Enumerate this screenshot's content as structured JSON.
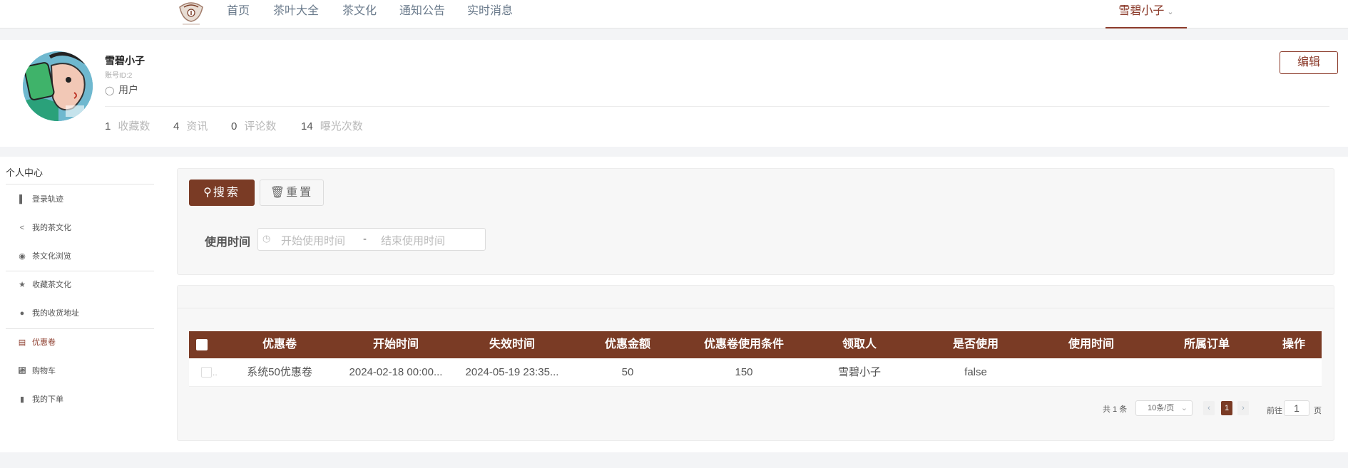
{
  "nav": {
    "items": [
      {
        "label": "首页"
      },
      {
        "label": "茶叶大全"
      },
      {
        "label": "茶文化"
      },
      {
        "label": "通知公告"
      },
      {
        "label": "实时消息"
      }
    ],
    "user_menu_label": "雪碧小子"
  },
  "profile": {
    "username": "雪碧小子",
    "account_id": "账号ID:2",
    "role": "用户",
    "edit_label": "编辑",
    "stats": [
      {
        "value": "1",
        "label": "收藏数"
      },
      {
        "value": "4",
        "label": "资讯"
      },
      {
        "value": "0",
        "label": "评论数"
      },
      {
        "value": "14",
        "label": "曝光次数"
      }
    ]
  },
  "sidebar": {
    "title": "个人中心",
    "items": [
      {
        "label": "登录轨迹",
        "icon": "bar-chart-icon"
      },
      {
        "label": "我的茶文化",
        "icon": "share-icon"
      },
      {
        "label": "茶文化浏览",
        "icon": "eye-icon"
      },
      {
        "label": "收藏茶文化",
        "icon": "star-icon"
      },
      {
        "label": "我的收货地址",
        "icon": "location-icon"
      },
      {
        "label": "优惠卷",
        "icon": "coupon-icon",
        "active": true
      },
      {
        "label": "购物车",
        "icon": "cart-icon"
      },
      {
        "label": "我的下单",
        "icon": "clipboard-icon"
      }
    ]
  },
  "search": {
    "search_label": "搜索",
    "reset_label": "重置",
    "field_label": "使用时间",
    "start_placeholder": "开始使用时间",
    "separator": "-",
    "end_placeholder": "结束使用时间"
  },
  "table": {
    "columns": [
      "优惠卷",
      "开始时间",
      "失效时间",
      "优惠金额",
      "优惠卷使用条件",
      "领取人",
      "是否使用",
      "使用时间",
      "所属订单",
      "操作"
    ],
    "rows": [
      {
        "checkbox_suffix": "..",
        "cells": [
          "系统50优惠卷",
          "2024-02-18 00:00...",
          "2024-05-19 23:35...",
          "50",
          "150",
          "雪碧小子",
          "false",
          "",
          "",
          ""
        ]
      }
    ]
  },
  "pagination": {
    "total_text": "共 1 条",
    "page_size": "10条/页",
    "current_page": "1",
    "goto_label": "前往",
    "goto_value": "1",
    "page_suffix": "页"
  },
  "colors": {
    "accent": "#7a3b25",
    "accent_text": "#8b3a2a"
  }
}
